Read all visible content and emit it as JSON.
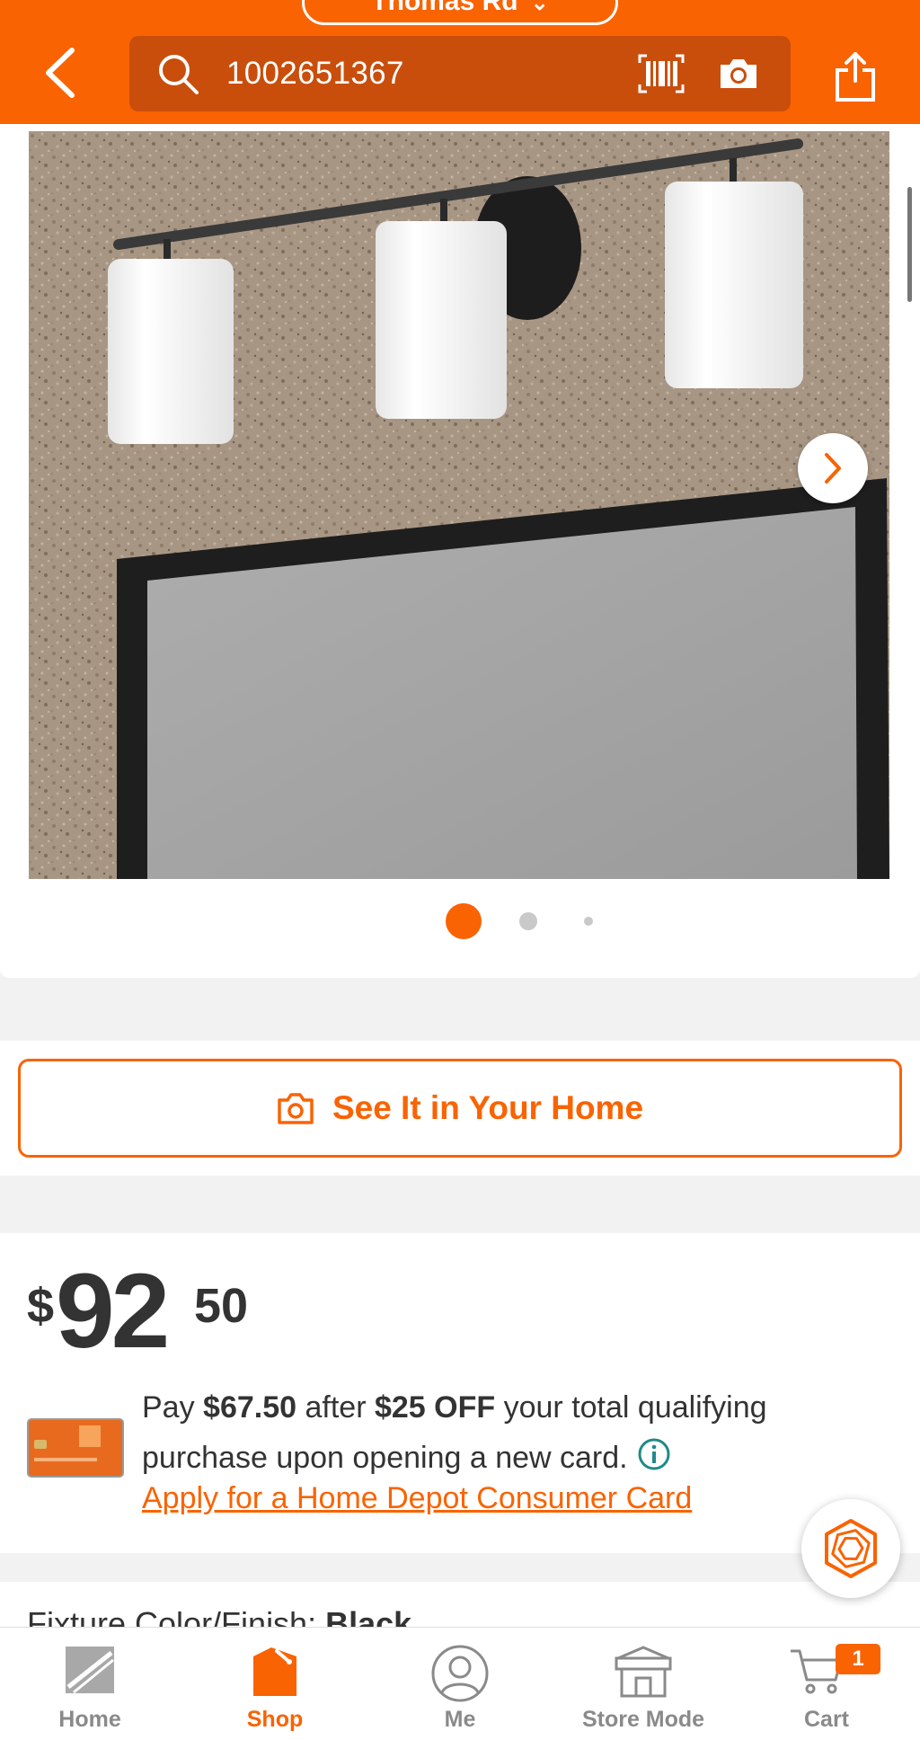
{
  "header": {
    "store_name": "Thomas Rd",
    "search": {
      "value": "1002651367"
    }
  },
  "gallery": {
    "slide_count": 3,
    "current_slide": 1
  },
  "ar": {
    "label": "See It in Your Home"
  },
  "price": {
    "currency": "$",
    "dollars": "92",
    "cents": "50"
  },
  "promo": {
    "pay_prefix": "Pay ",
    "pay_amount": "$67.50",
    "after_text": " after ",
    "discount": "$25 OFF",
    "rest_text": " your total qualifying purchase upon opening a new card.",
    "apply_link": "Apply for a Home Depot Consumer Card"
  },
  "next_section": {
    "label": "Fixture Color/Finish: ",
    "value": "Black"
  },
  "nav": {
    "items": [
      {
        "label": "Home"
      },
      {
        "label": "Shop"
      },
      {
        "label": "Me"
      },
      {
        "label": "Store Mode"
      },
      {
        "label": "Cart"
      }
    ],
    "cart_count": "1"
  },
  "colors": {
    "brand_orange": "#f96302",
    "search_bg": "#c94e0c"
  }
}
